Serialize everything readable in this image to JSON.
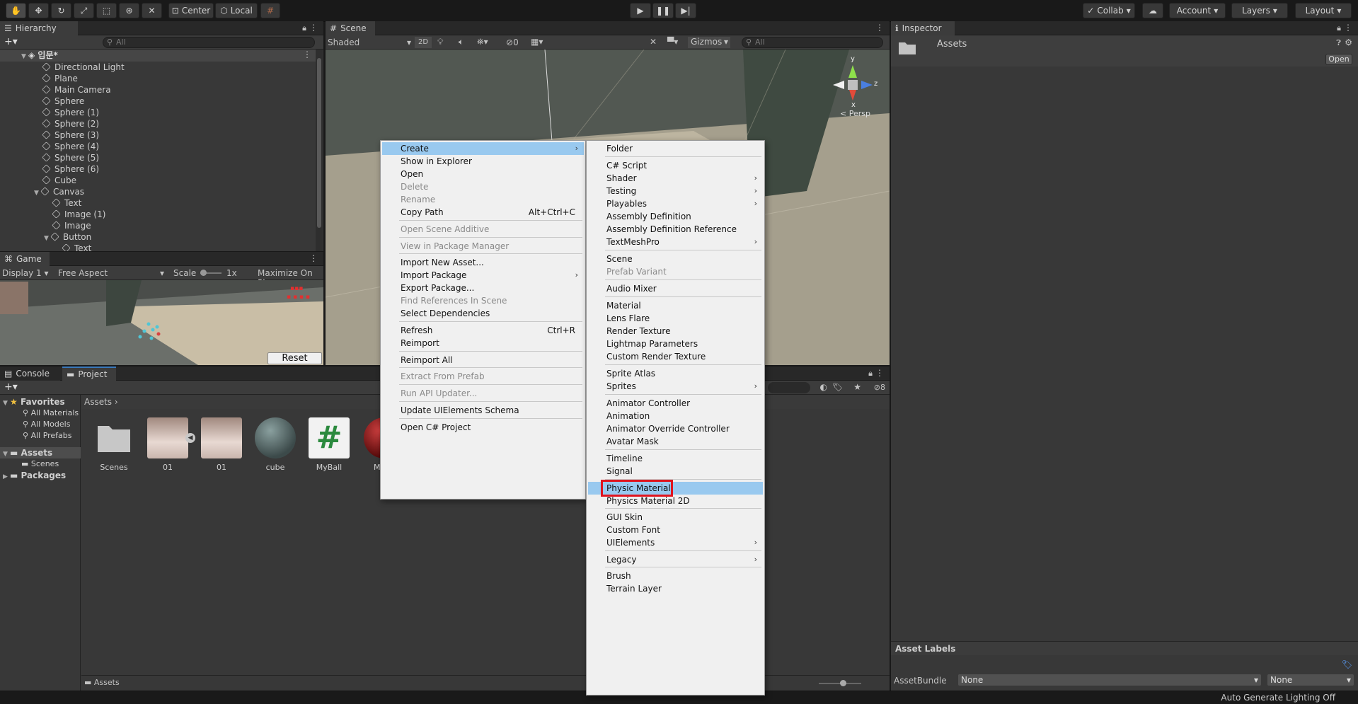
{
  "toolbar": {
    "pivot_center": "Center",
    "pivot_local": "Local",
    "collab": "Collab",
    "account": "Account",
    "layers": "Layers",
    "layout": "Layout"
  },
  "hierarchy": {
    "tab": "Hierarchy",
    "search_placeholder": "All",
    "scene_name": "입문*",
    "items": [
      {
        "label": "Directional Light"
      },
      {
        "label": "Plane"
      },
      {
        "label": "Main Camera"
      },
      {
        "label": "Sphere"
      },
      {
        "label": "Sphere (1)"
      },
      {
        "label": "Sphere (2)"
      },
      {
        "label": "Sphere (3)"
      },
      {
        "label": "Sphere (4)"
      },
      {
        "label": "Sphere (5)"
      },
      {
        "label": "Sphere (6)"
      },
      {
        "label": "Cube"
      },
      {
        "label": "Canvas"
      },
      {
        "label": "Text"
      },
      {
        "label": "Image (1)"
      },
      {
        "label": "Image"
      },
      {
        "label": "Button"
      },
      {
        "label": "Text"
      }
    ]
  },
  "game": {
    "tab": "Game",
    "display": "Display 1",
    "aspect": "Free Aspect",
    "scale_label": "Scale",
    "scale_value": "1x",
    "maximize": "Maximize On Pla",
    "reset_button": "Reset"
  },
  "scene": {
    "tab": "Scene",
    "shading": "Shaded",
    "mode_2d": "2D",
    "hidden_count": "0",
    "gizmos": "Gizmos",
    "search_placeholder": "All",
    "axis_x": "x",
    "axis_y": "y",
    "axis_z": "z",
    "persp": "< Persp"
  },
  "inspector": {
    "tab": "Inspector",
    "title": "Assets",
    "open_button": "Open",
    "asset_labels": "Asset Labels",
    "asset_bundle_label": "AssetBundle",
    "asset_bundle_value": "None",
    "asset_bundle_variant": "None"
  },
  "bottom": {
    "tab_console": "Console",
    "tab_project": "Project",
    "hidden_packages_count": "8",
    "favorites": "Favorites",
    "fav_items": [
      "All Materials",
      "All Models",
      "All Prefabs"
    ],
    "assets": "Assets",
    "scenes": "Scenes",
    "packages": "Packages",
    "breadcrumb": "Assets",
    "footer_path": "Assets",
    "asset_items": [
      {
        "label": "Scenes"
      },
      {
        "label": "01"
      },
      {
        "label": "01"
      },
      {
        "label": "cube"
      },
      {
        "label": "MyBall"
      },
      {
        "label": "My"
      }
    ]
  },
  "status_bar": {
    "text": "Auto Generate Lighting Off"
  },
  "context_menu": {
    "items": [
      {
        "label": "Create",
        "arrow": "›"
      },
      {
        "label": "Show in Explorer"
      },
      {
        "label": "Open"
      },
      {
        "label": "Delete"
      },
      {
        "label": "Rename"
      },
      {
        "label": "Copy Path",
        "shortcut": "Alt+Ctrl+C"
      },
      {
        "label": "Open Scene Additive"
      },
      {
        "label": "View in Package Manager"
      },
      {
        "label": "Import New Asset..."
      },
      {
        "label": "Import Package",
        "arrow": "›"
      },
      {
        "label": "Export Package..."
      },
      {
        "label": "Find References In Scene"
      },
      {
        "label": "Select Dependencies"
      },
      {
        "label": "Refresh",
        "shortcut": "Ctrl+R"
      },
      {
        "label": "Reimport"
      },
      {
        "label": "Reimport All"
      },
      {
        "label": "Extract From Prefab"
      },
      {
        "label": "Run API Updater..."
      },
      {
        "label": "Update UIElements Schema"
      },
      {
        "label": "Open C# Project"
      }
    ]
  },
  "create_submenu": {
    "items": [
      {
        "label": "Folder"
      },
      {
        "label": "C# Script"
      },
      {
        "label": "Shader",
        "arrow": "›"
      },
      {
        "label": "Testing",
        "arrow": "›"
      },
      {
        "label": "Playables",
        "arrow": "›"
      },
      {
        "label": "Assembly Definition"
      },
      {
        "label": "Assembly Definition Reference"
      },
      {
        "label": "TextMeshPro",
        "arrow": "›"
      },
      {
        "label": "Scene"
      },
      {
        "label": "Prefab Variant"
      },
      {
        "label": "Audio Mixer"
      },
      {
        "label": "Material"
      },
      {
        "label": "Lens Flare"
      },
      {
        "label": "Render Texture"
      },
      {
        "label": "Lightmap Parameters"
      },
      {
        "label": "Custom Render Texture"
      },
      {
        "label": "Sprite Atlas"
      },
      {
        "label": "Sprites",
        "arrow": "›"
      },
      {
        "label": "Animator Controller"
      },
      {
        "label": "Animation"
      },
      {
        "label": "Animator Override Controller"
      },
      {
        "label": "Avatar Mask"
      },
      {
        "label": "Timeline"
      },
      {
        "label": "Signal"
      },
      {
        "label": "Physic Material"
      },
      {
        "label": "Physics Material 2D"
      },
      {
        "label": "GUI Skin"
      },
      {
        "label": "Custom Font"
      },
      {
        "label": "UIElements",
        "arrow": "›"
      },
      {
        "label": "Legacy",
        "arrow": "›"
      },
      {
        "label": "Brush"
      },
      {
        "label": "Terrain Layer"
      }
    ]
  },
  "colors": {
    "menu_highlight": "#99c9ef",
    "annotation_box": "#e0141e",
    "panel_bg": "#383838"
  }
}
